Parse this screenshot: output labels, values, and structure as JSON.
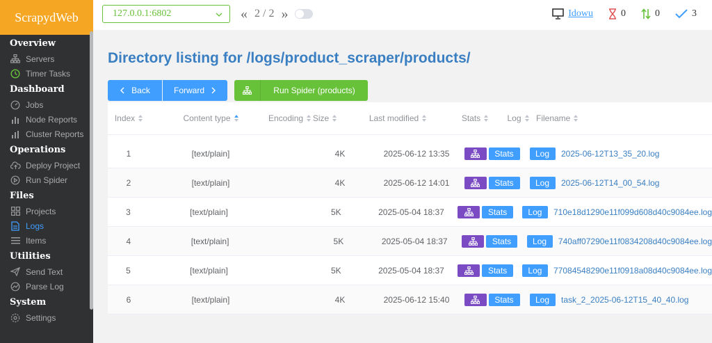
{
  "app": {
    "title": "ScrapydWeb"
  },
  "sidebar": {
    "groups": [
      {
        "label": "Overview",
        "items": [
          {
            "label": "Servers",
            "icon": "servers-icon"
          },
          {
            "label": "Timer Tasks",
            "icon": "timer-icon"
          }
        ]
      },
      {
        "label": "Dashboard",
        "items": [
          {
            "label": "Jobs",
            "icon": "gauge-icon"
          },
          {
            "label": "Node Reports",
            "icon": "bar-chart-icon"
          },
          {
            "label": "Cluster Reports",
            "icon": "bar-chart-icon"
          }
        ]
      },
      {
        "label": "Operations",
        "items": [
          {
            "label": "Deploy Project",
            "icon": "upload-icon"
          },
          {
            "label": "Run Spider",
            "icon": "play-icon"
          }
        ]
      },
      {
        "label": "Files",
        "items": [
          {
            "label": "Projects",
            "icon": "grid-icon"
          },
          {
            "label": "Logs",
            "icon": "document-icon"
          },
          {
            "label": "Items",
            "icon": "menu-icon"
          }
        ]
      },
      {
        "label": "Utilities",
        "items": [
          {
            "label": "Send Text",
            "icon": "send-icon"
          },
          {
            "label": "Parse Log",
            "icon": "chart-line-icon"
          }
        ]
      },
      {
        "label": "System",
        "items": [
          {
            "label": "Settings",
            "icon": "gear-icon"
          }
        ]
      }
    ]
  },
  "topbar": {
    "node": "127.0.0.1:6802",
    "pager": {
      "prev": "«",
      "count": "2 / 2",
      "next": "»"
    },
    "user": "Idowu",
    "pending": "0",
    "running": "0",
    "finished": "3"
  },
  "main": {
    "title": "Directory listing for /logs/product_scraper/products/",
    "back_label": "Back",
    "forward_label": "Forward",
    "run_spider_label": "Run Spider (products)"
  },
  "table": {
    "headers": {
      "index": "Index",
      "ctype": "Content type",
      "encoding": "Encoding",
      "size": "Size",
      "modified": "Last modified",
      "stats": "Stats",
      "log": "Log",
      "filename": "Filename"
    },
    "stats_label": "Stats",
    "log_label": "Log",
    "rows": [
      {
        "index": "1",
        "ctype": "[text/plain]",
        "size": "4K",
        "modified": "2025-06-12 13:35",
        "filename": "2025-06-12T13_35_20.log"
      },
      {
        "index": "2",
        "ctype": "[text/plain]",
        "size": "4K",
        "modified": "2025-06-12 14:01",
        "filename": "2025-06-12T14_00_54.log"
      },
      {
        "index": "3",
        "ctype": "[text/plain]",
        "size": "5K",
        "modified": "2025-05-04 18:37",
        "filename": "710e18d1290e11f099d608d40c9084ee.log"
      },
      {
        "index": "4",
        "ctype": "[text/plain]",
        "size": "5K",
        "modified": "2025-05-04 18:37",
        "filename": "740aff07290e11f0834208d40c9084ee.log"
      },
      {
        "index": "5",
        "ctype": "[text/plain]",
        "size": "5K",
        "modified": "2025-05-04 18:37",
        "filename": "77084548290e11f0918a08d40c9084ee.log"
      },
      {
        "index": "6",
        "ctype": "[text/plain]",
        "size": "4K",
        "modified": "2025-06-12 15:40",
        "filename": "task_2_2025-06-12T15_40_40.log"
      }
    ]
  },
  "colors": {
    "accent": "#409eff",
    "brand": "#f5a623",
    "success": "#67c23a",
    "stats_icon": "#7b4bc4",
    "sidebar_bg": "#303133"
  }
}
